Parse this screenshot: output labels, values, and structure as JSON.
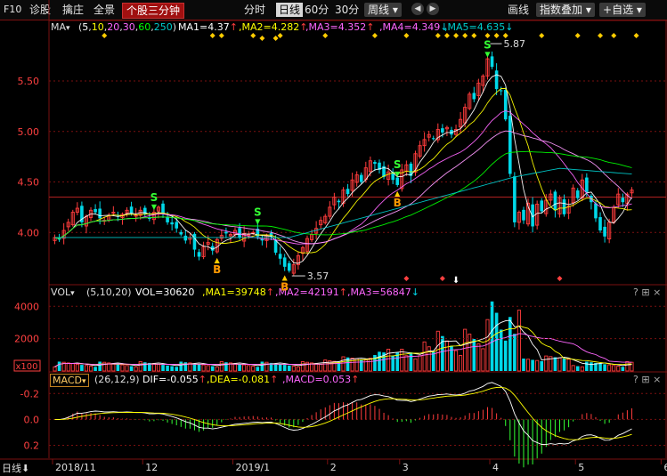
{
  "toolbar": {
    "f10": "F10",
    "diagnose": "诊股",
    "chip": "擒庄",
    "fullscreen": "全景",
    "active_tab": "个股三分钟",
    "periods": [
      "分时",
      "日线",
      "60分",
      "30分",
      "周线"
    ],
    "selected_period": "日线",
    "draw": "画线",
    "index_overlay": "指数叠加",
    "watchlist": "自选"
  },
  "ma_bar": {
    "label": "MA",
    "params_open": "(",
    "params": [
      {
        "v": "5",
        "color": "#ffffff"
      },
      {
        "v": "10",
        "color": "#ffff00"
      },
      {
        "v": "20",
        "color": "#ff66ff"
      },
      {
        "v": "30",
        "color": "#ff66ff"
      },
      {
        "v": "60",
        "color": "#00ff00"
      },
      {
        "v": "250",
        "color": "#00cccc"
      }
    ],
    "params_close": ")",
    "ma1": "MA1=4.37",
    "ma2": ",MA2=4.282",
    "ma3": ",MA3=4.352",
    "ma4": ",MA4=4.349",
    "ma5": ",MA5=4.635",
    "arrow_up": "↑",
    "arrow_down": "↓"
  },
  "vol_bar": {
    "label": "VOL",
    "params": "(5,10,20)",
    "vol": "VOL=30620",
    "ma1": ",MA1=39748",
    "ma2": ",MA2=42191",
    "ma3": ",MA3=56847"
  },
  "macd_bar": {
    "label": "MACD",
    "params": "(26,12,9)",
    "dif": "DIF=-0.055",
    "dea": ",DEA=-0.081",
    "macd": ",MACD=0.053"
  },
  "price_axis": [
    "5.50",
    "5.00",
    "4.50",
    "4.00"
  ],
  "vol_axis": [
    "4000",
    "2000",
    "x100"
  ],
  "macd_axis": [
    "0.2",
    "0.0",
    "-0.2"
  ],
  "high_label": "5.87",
  "low_label": "3.57",
  "signals": {
    "buy": "B",
    "sell": "S"
  },
  "date_axis": {
    "period": "日线",
    "labels": [
      "2018/11",
      "12",
      "2019/1",
      "2",
      "3",
      "4",
      "5",
      "6"
    ]
  },
  "panel_buttons": {
    "help": "?",
    "zoom": "⊞",
    "close": "×"
  },
  "colors": {
    "up": "#ff3c3c",
    "down": "#00d8e8",
    "ma5": "#ffffff",
    "ma10": "#ffff00",
    "ma20": "#ff66ff",
    "ma60": "#00ff00",
    "ma250": "#00cccc",
    "grid": "#7a1010",
    "axis_text": "#ff4040"
  },
  "chart_data": {
    "type": "candlestick",
    "x_range": [
      "2018-10-29",
      "2019-06-14"
    ],
    "price_ylim": [
      3.5,
      5.95
    ],
    "price_ticks": [
      4.0,
      4.5,
      5.0,
      5.5
    ],
    "marked_high": 5.87,
    "marked_low": 3.57,
    "closes": [
      3.95,
      3.93,
      4.02,
      4.1,
      4.2,
      4.24,
      4.1,
      4.16,
      4.22,
      4.2,
      4.14,
      4.12,
      4.17,
      4.2,
      4.16,
      4.18,
      4.22,
      4.19,
      4.17,
      4.22,
      4.18,
      4.14,
      4.2,
      4.25,
      4.18,
      4.1,
      4.08,
      4.04,
      3.98,
      3.92,
      3.95,
      3.83,
      3.76,
      3.86,
      3.9,
      3.82,
      3.93,
      3.97,
      3.99,
      3.98,
      4.02,
      3.95,
      3.99,
      3.98,
      4.0,
      3.96,
      3.92,
      3.97,
      3.96,
      3.8,
      3.74,
      3.66,
      3.62,
      3.68,
      3.77,
      3.85,
      3.94,
      3.98,
      4.04,
      4.12,
      4.16,
      4.25,
      4.35,
      4.3,
      4.42,
      4.38,
      4.52,
      4.57,
      4.5,
      4.64,
      4.71,
      4.68,
      4.62,
      4.55,
      4.6,
      4.52,
      4.47,
      4.62,
      4.67,
      4.56,
      4.78,
      4.86,
      4.92,
      4.97,
      4.93,
      5.02,
      4.99,
      5.04,
      4.97,
      5.02,
      5.12,
      5.24,
      5.37,
      5.32,
      5.48,
      5.55,
      5.72,
      5.64,
      5.42,
      5.4,
      5.12,
      4.58,
      4.1,
      4.2,
      4.12,
      4.29,
      4.06,
      4.28,
      4.21,
      4.32,
      4.38,
      4.22,
      4.34,
      4.18,
      4.26,
      4.44,
      4.34,
      4.52,
      4.4,
      4.3,
      4.14,
      4.02,
      3.96,
      4.1,
      4.25,
      4.38,
      4.3,
      4.38,
      4.42
    ],
    "ma_values": {
      "MA1": 4.37,
      "MA2": 4.282,
      "MA3": 4.352,
      "MA4": 4.349,
      "MA5": 4.635
    },
    "volume_ylim": [
      0,
      4400
    ],
    "volume_ticks": [
      2000,
      4000
    ],
    "volume_last": {
      "VOL": 30620,
      "MA1": 39748,
      "MA2": 42191,
      "MA3": 56847
    },
    "macd_ylim": [
      -0.3,
      0.25
    ],
    "macd_ticks": [
      -0.2,
      0.0,
      0.2
    ],
    "macd_last": {
      "DIF": -0.055,
      "DEA": -0.081,
      "MACD": 0.053
    }
  }
}
